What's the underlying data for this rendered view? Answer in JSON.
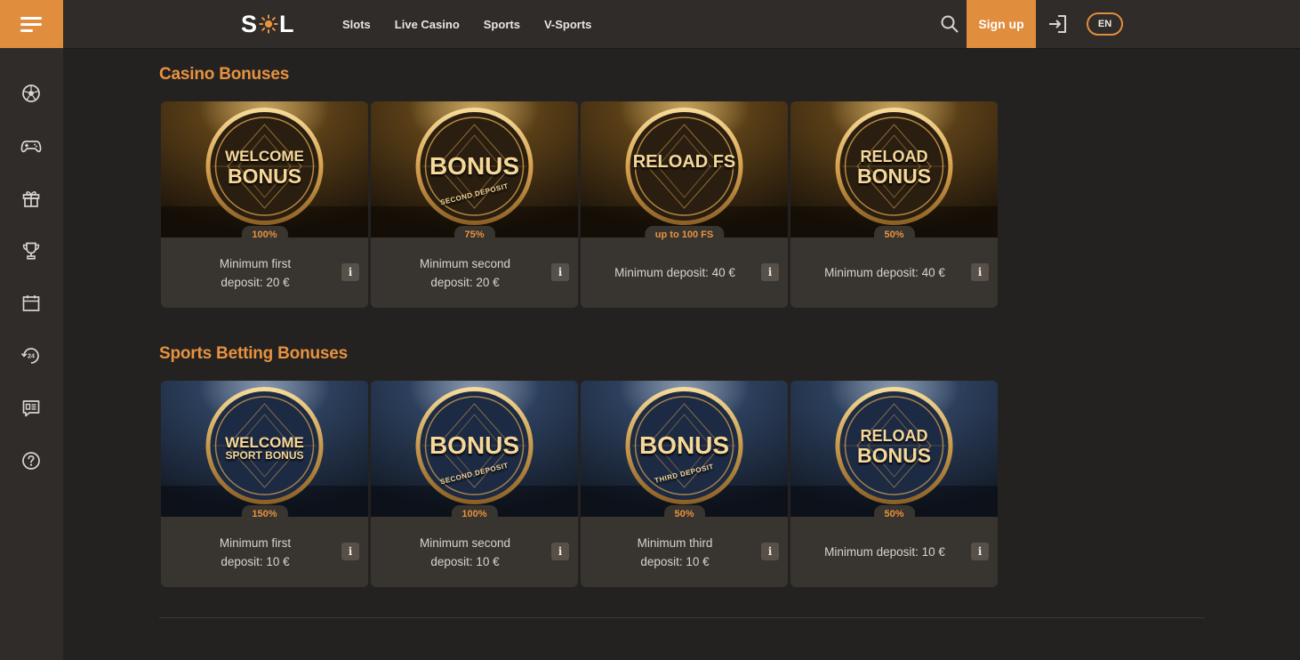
{
  "header": {
    "logo": {
      "left": "S",
      "right": "L"
    },
    "nav": [
      "Slots",
      "Live Casino",
      "Sports",
      "V-Sports"
    ],
    "signup_label": "Sign up",
    "language": "EN"
  },
  "sidebar": {
    "icons": [
      "football-icon",
      "gamepad-icon",
      "gift-icon",
      "trophy-icon",
      "calendar-icon",
      "support-24-icon",
      "chat-icon",
      "help-icon"
    ]
  },
  "colors": {
    "accent": "#e08d3d",
    "background": "#242221",
    "panel": "#2f2c2a",
    "card": "#38342f"
  },
  "casino": {
    "title": "Casino Bonuses",
    "cards": [
      {
        "line1": "WELCOME",
        "line2": "BONUS",
        "ring": "",
        "pct": "100%",
        "desc": "Minimum first deposit: 20 €"
      },
      {
        "line1": "",
        "line2": "BONUS",
        "ring": "SECOND DEPOSIT",
        "pct": "75%",
        "desc": "Minimum second deposit: 20 €"
      },
      {
        "line1": "",
        "line2": "RELOAD FS",
        "ring": "",
        "pct": "up to 100 FS",
        "desc": "Minimum deposit: 40 €"
      },
      {
        "line1": "RELOAD",
        "line2": "BONUS",
        "ring": "",
        "pct": "50%",
        "desc": "Minimum deposit: 40 €"
      }
    ]
  },
  "sports": {
    "title": "Sports Betting Bonuses",
    "cards": [
      {
        "line1": "WELCOME",
        "line2": "SPORT BONUS",
        "ring": "",
        "pct": "150%",
        "desc": "Minimum first deposit: 10 €"
      },
      {
        "line1": "",
        "line2": "BONUS",
        "ring": "SECOND DEPOSIT",
        "pct": "100%",
        "desc": "Minimum second deposit: 10 €"
      },
      {
        "line1": "",
        "line2": "BONUS",
        "ring": "THIRD DEPOSIT",
        "pct": "50%",
        "desc": "Minimum third deposit: 10 €"
      },
      {
        "line1": "RELOAD",
        "line2": "BONUS",
        "ring": "",
        "pct": "50%",
        "desc": "Minimum deposit: 10 €"
      }
    ]
  },
  "info_glyph": "i"
}
